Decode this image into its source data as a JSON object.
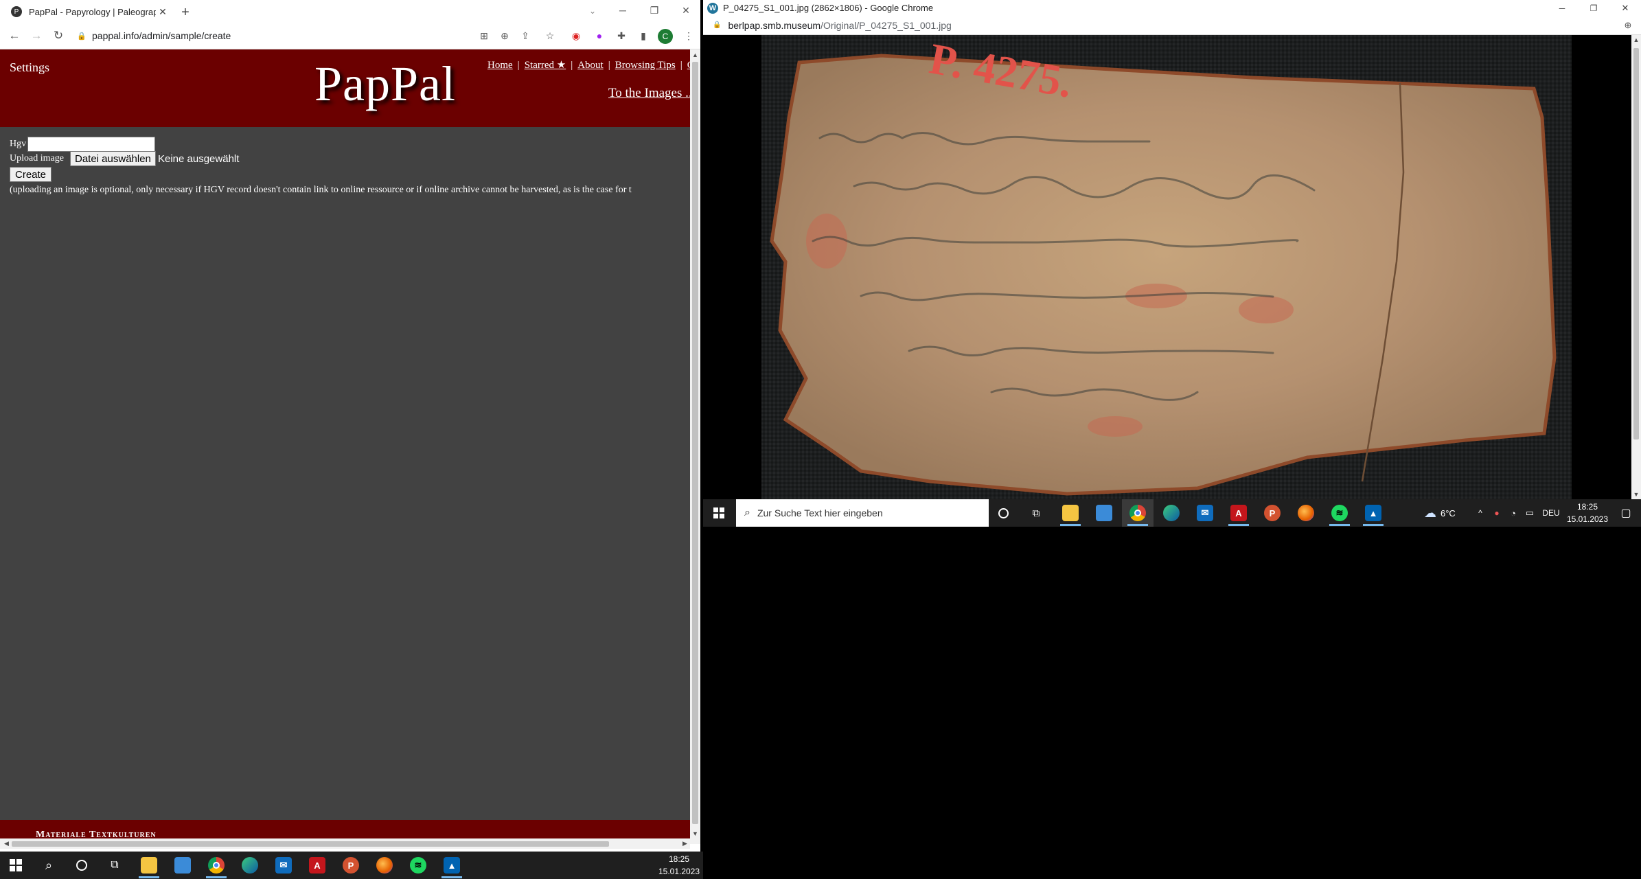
{
  "left_window": {
    "tab_title": "PapPal - Papyrology | Paleograph",
    "tab_favicon": "P",
    "new_tab": "+",
    "url": "pappal.info/admin/sample/create",
    "profile_initial": "C",
    "page": {
      "settings_label": "Settings",
      "logo": "PapPal",
      "nav": [
        "Home",
        "Starred ★",
        "About",
        "Browsing Tips",
        "C"
      ],
      "nav_sep": "|",
      "to_images": "To the Images ...",
      "form": {
        "hgv_label": "Hgv",
        "hgv_value": "",
        "upload_label": "Upload image",
        "file_button": "Datei auswählen",
        "file_status": "Keine ausgewählt",
        "create_button": "Create",
        "note": "(uploading an image is optional, only necessary if HGV record doesn't contain link to online ressource or if online archive cannot be harvested, as is the case for t"
      },
      "footer_text": "Materiale Textkulturen"
    },
    "colors": {
      "header_bg": "#6b0000",
      "page_bg": "#424242"
    }
  },
  "right_window": {
    "title": "P_04275_S1_001.jpg (2862×1806) - Google Chrome",
    "url_host": "berlpap.smb.museum",
    "url_path": "/Original/P_04275_S1_001.jpg",
    "image_inscription": "P. 4275."
  },
  "taskbar_left": {
    "time": "18:25",
    "date": "15.01.2023",
    "apps": [
      "start-icon",
      "search-icon",
      "cortana-icon",
      "task-view-icon",
      "file-explorer-icon",
      "ms-store-icon",
      "chrome-icon",
      "edge-icon",
      "mail-icon",
      "acrobat-icon",
      "powerpoint-icon",
      "firefox-icon",
      "spotify-icon",
      "photos-icon"
    ]
  },
  "taskbar_right": {
    "search_placeholder": "Zur Suche Text hier eingeben",
    "weather": "6°C",
    "language": "DEU",
    "time": "18:25",
    "date": "15.01.2023"
  }
}
